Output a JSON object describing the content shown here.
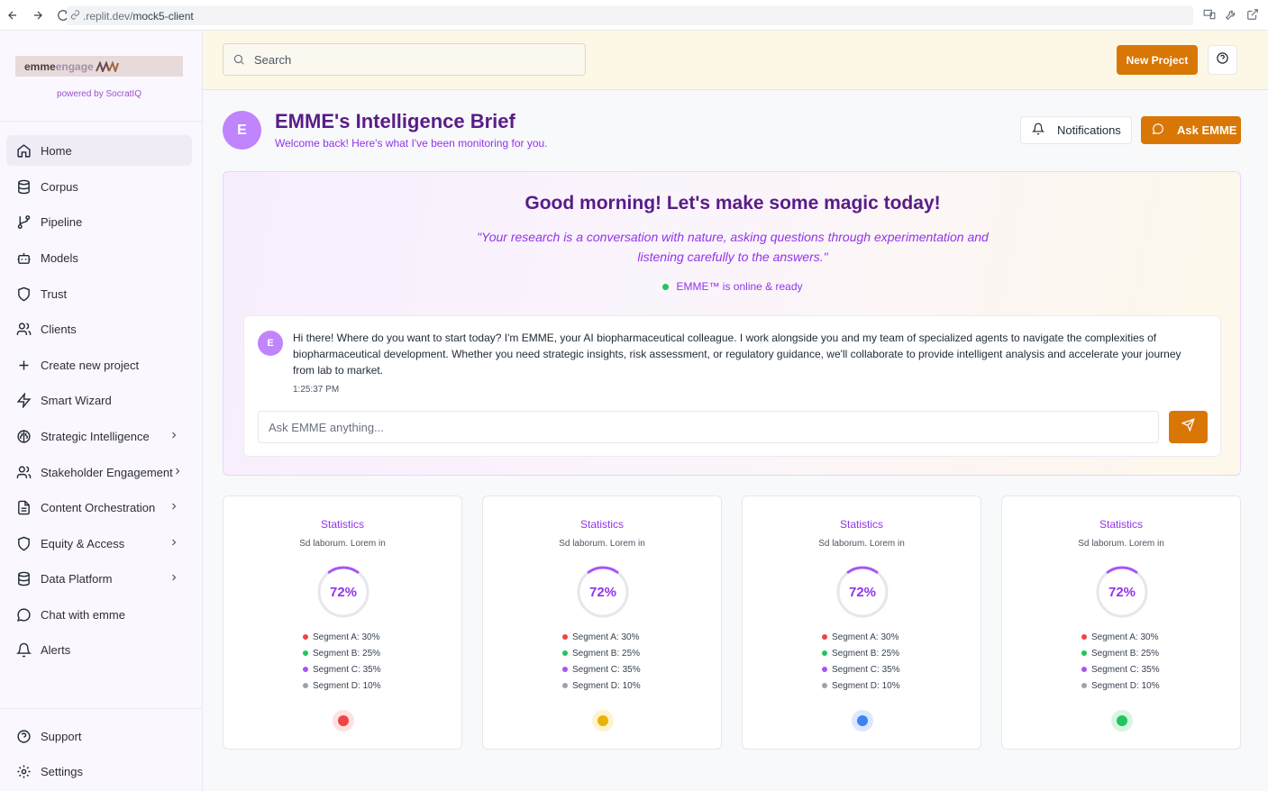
{
  "browser": {
    "url_prefix": ".replit.dev/",
    "url_path": "mock5-client"
  },
  "brand": {
    "logo_part1": "emme",
    "logo_part2": "engage",
    "powered_by": "powered by SocratIQ"
  },
  "sidebar": {
    "items": [
      {
        "label": "Home",
        "icon": "home-icon"
      },
      {
        "label": "Corpus",
        "icon": "database-icon"
      },
      {
        "label": "Pipeline",
        "icon": "git-branch-icon"
      },
      {
        "label": "Models",
        "icon": "bot-icon"
      },
      {
        "label": "Trust",
        "icon": "shield-icon"
      },
      {
        "label": "Clients",
        "icon": "users-icon"
      },
      {
        "label": "Create new project",
        "icon": "plus-icon"
      },
      {
        "label": "Smart Wizard",
        "icon": "zap-icon"
      },
      {
        "label": "Strategic Intelligence",
        "icon": "brain-icon"
      },
      {
        "label": "Stakeholder Engagement",
        "icon": "users-icon"
      },
      {
        "label": "Content Orchestration",
        "icon": "file-text-icon"
      },
      {
        "label": "Equity & Access",
        "icon": "shield-icon"
      },
      {
        "label": "Data Platform",
        "icon": "database-icon"
      },
      {
        "label": "Chat with emme",
        "icon": "message-circle-icon"
      },
      {
        "label": "Alerts",
        "icon": "bell-icon"
      }
    ],
    "footer": [
      {
        "label": "Support",
        "icon": "help-circle-icon"
      },
      {
        "label": "Settings",
        "icon": "gear-icon"
      }
    ]
  },
  "topbar": {
    "search_placeholder": "Search",
    "new_project_label": "New Project"
  },
  "header": {
    "avatar_letter": "E",
    "title": "EMME's Intelligence Brief",
    "subtitle": "Welcome back! Here's what I've been monitoring for you.",
    "notifications_label": "Notifications",
    "ask_label": "Ask EMME"
  },
  "hero": {
    "title": "Good morning! Let's make some magic today!",
    "quote": "\"Your research is a conversation with nature, asking questions through experimentation and listening carefully to the answers.\"",
    "status": "EMME™ is online & ready"
  },
  "chat": {
    "avatar_letter": "E",
    "message": "Hi there! Where do you want to start today? I'm EMME, your AI biopharmaceutical colleague. I work alongside you and my team of specialized agents to navigate the complexities of biopharmaceutical development. Whether you need strategic insights, risk assessment, or regulatory guidance, we'll collaborate to provide intelligent analysis and accelerate your journey from lab to market.",
    "time": "1:25:37 PM",
    "input_placeholder": "Ask EMME anything..."
  },
  "cards": [
    {
      "title": "Statistics",
      "subtitle": "Sd laborum. Lorem in",
      "value_label": "72%",
      "value": 72,
      "indicator_color": "#ef4444",
      "indicator_bg": "#fde2e2",
      "segments": [
        {
          "label": "Segment A: 30%",
          "color": "#ef4444"
        },
        {
          "label": "Segment B: 25%",
          "color": "#22c55e"
        },
        {
          "label": "Segment C: 35%",
          "color": "#a855f7"
        },
        {
          "label": "Segment D: 10%",
          "color": "#9ca3af"
        }
      ]
    },
    {
      "title": "Statistics",
      "subtitle": "Sd laborum. Lorem in",
      "value_label": "72%",
      "value": 72,
      "indicator_color": "#eab308",
      "indicator_bg": "#fdf3cf",
      "segments": [
        {
          "label": "Segment A: 30%",
          "color": "#ef4444"
        },
        {
          "label": "Segment B: 25%",
          "color": "#22c55e"
        },
        {
          "label": "Segment C: 35%",
          "color": "#a855f7"
        },
        {
          "label": "Segment D: 10%",
          "color": "#9ca3af"
        }
      ]
    },
    {
      "title": "Statistics",
      "subtitle": "Sd laborum. Lorem in",
      "value_label": "72%",
      "value": 72,
      "indicator_color": "#3b82f6",
      "indicator_bg": "#dbe8fd",
      "segments": [
        {
          "label": "Segment A: 30%",
          "color": "#ef4444"
        },
        {
          "label": "Segment B: 25%",
          "color": "#22c55e"
        },
        {
          "label": "Segment C: 35%",
          "color": "#a855f7"
        },
        {
          "label": "Segment D: 10%",
          "color": "#9ca3af"
        }
      ]
    },
    {
      "title": "Statistics",
      "subtitle": "Sd laborum. Lorem in",
      "value_label": "72%",
      "value": 72,
      "indicator_color": "#22c55e",
      "indicator_bg": "#d8f5e2",
      "segments": [
        {
          "label": "Segment A: 30%",
          "color": "#ef4444"
        },
        {
          "label": "Segment B: 25%",
          "color": "#22c55e"
        },
        {
          "label": "Segment C: 35%",
          "color": "#a855f7"
        },
        {
          "label": "Segment D: 10%",
          "color": "#9ca3af"
        }
      ]
    }
  ],
  "colors": {
    "accent": "#d97706",
    "purple": "#9333ea",
    "purple_dark": "#581c87"
  }
}
